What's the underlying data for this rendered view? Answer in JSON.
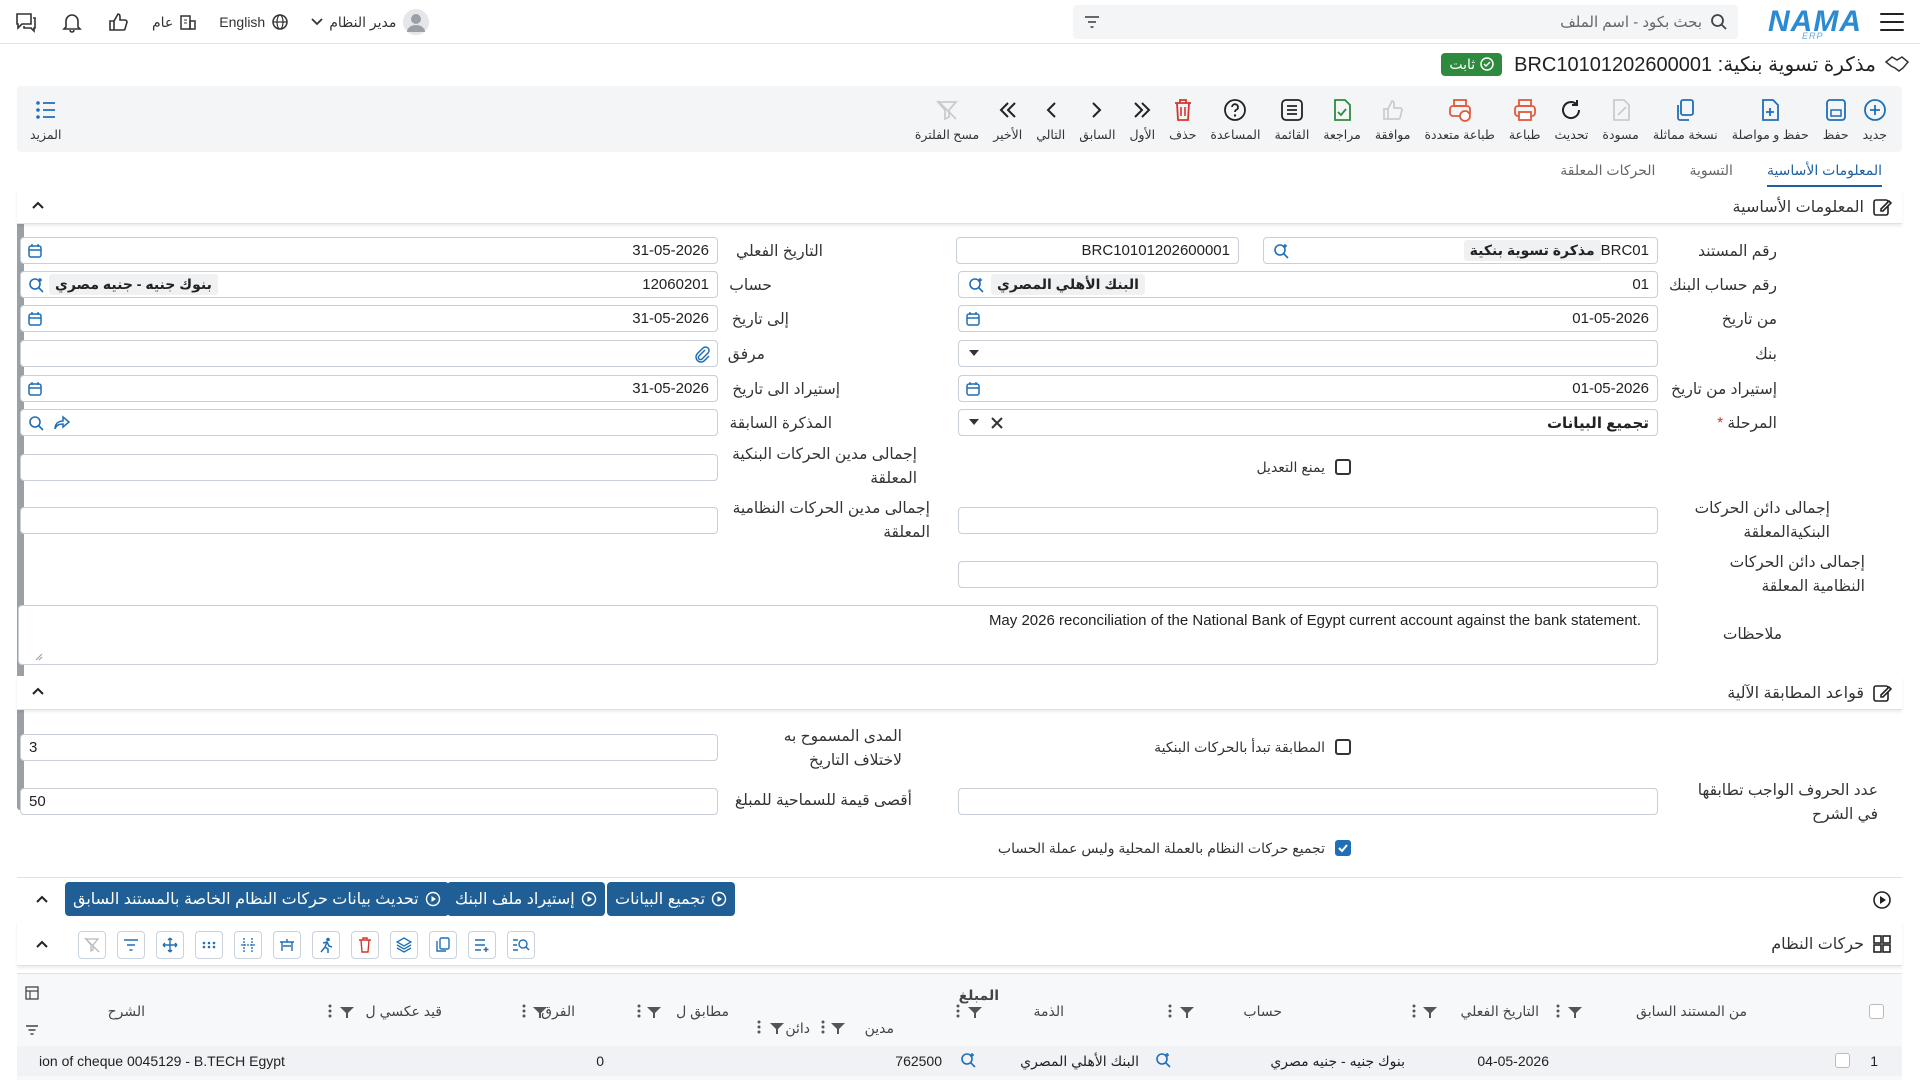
{
  "app": {
    "brand": "NAMA",
    "brand_sub": "ERP"
  },
  "search": {
    "placeholder": "بحث بكود - اسم الملف"
  },
  "topright": {
    "user": "مدير النظام",
    "language": "English",
    "scope": "عام"
  },
  "document": {
    "title": "مذكرة تسوية بنكية: BRC10101202600001",
    "status": "ثابت"
  },
  "toolbar": {
    "new": "جديد",
    "save": "حفظ",
    "save_continue": "حفظ و مواصلة",
    "copy": "نسخة مماثلة",
    "draft": "مسودة",
    "refresh": "تحديث",
    "print": "طباعة",
    "multi_print": "طباعة متعددة",
    "approve": "موافقة",
    "review": "مراجعة",
    "list": "القائمة",
    "help": "المساعدة",
    "delete": "حذف",
    "first": "الأول",
    "prev": "السابق",
    "next": "التالي",
    "last": "الأخير",
    "clear_filter": "مسح الفلترة",
    "more": "المزيد"
  },
  "tabs": [
    {
      "label": "المعلومات الأساسية",
      "active": true
    },
    {
      "label": "التسوية",
      "active": false
    },
    {
      "label": "الحركات المعلقة",
      "active": false
    }
  ],
  "basic": {
    "section_title": "المعلومات الأساسية",
    "doc_no_label": "رقم المستند",
    "doc_no_code": "BRC01",
    "doc_type": "مذكرة تسوية بنكية",
    "doc_no": "BRC10101202600001",
    "actual_date_label": "التاريخ الفعلي",
    "actual_date": "31-05-2026",
    "bank_acc_label": "رقم حساب البنك",
    "bank_acc": "01",
    "bank_acc_name": "البنك الأهلي المصري",
    "account_label": "حساب",
    "account": "12060201",
    "account_name": "بنوك جنيه - جنيه مصري",
    "from_date_label": "من تاريخ",
    "from_date": "01-05-2026",
    "to_date_label": "إلى تاريخ",
    "to_date": "31-05-2026",
    "bank_label": "بنك",
    "attachment_label": "مرفق",
    "import_from_label": "إستيراد من تاريخ",
    "import_from": "01-05-2026",
    "import_to_label": "إستيراد الى تاريخ",
    "import_to": "31-05-2026",
    "stage_label": "المرحلة",
    "stage": "تجميع البيانات",
    "prev_note_label": "المذكرة السابقة",
    "prevent_edit_label": "يمنع التعديل",
    "bank_debit_label": "إجمالى مدين الحركات البنكية المعلقة",
    "bank_credit_label": "إجمالى دائن الحركات البنكيةالمعلقة",
    "sys_debit_label": "إجمالى مدين الحركات النظامية المعلقة",
    "sys_credit_label": "إجمالى دائن الحركات النظامية المعلقة",
    "notes_label": "ملاحظات",
    "notes": "May 2026 reconciliation of the National Bank of Egypt current account against the bank statement."
  },
  "rules": {
    "section_title": "قواعد المطابقة الآلية",
    "start_bank_label": "المطابقة تبدأ بالحركات البنكية",
    "date_tolerance_label": "المدى المسموح به لاختلاف التاريخ",
    "date_tolerance": "3",
    "chars_label": "عدد الحروف الواجب تطابقها في الشرح",
    "amount_tolerance_label": "أقصى قيمة للسماحية للمبلغ",
    "amount_tolerance": "50",
    "local_currency_label": "تجميع حركات النظام بالعملة المحلية وليس عملة الحساب"
  },
  "actions": {
    "collect": "تجميع البيانات",
    "import_bank": "إستيراد ملف البنك",
    "update_prev": "تحديث بيانات حركات النظام الخاصة بالمستند السابق"
  },
  "grid": {
    "title": "حركات النظام",
    "columns": {
      "from_prev": "من المستند السابق",
      "actual_date": "التاريخ الفعلي",
      "account": "حساب",
      "party": "الذمة",
      "amount": "المبلغ",
      "debit": "مدين",
      "credit": "دائن",
      "matched": "مطابق ل",
      "diff": "الفرق",
      "reverse": "قيد عكسي ل",
      "desc": "الشرح"
    },
    "rows": [
      {
        "n": "1",
        "date": "04-05-2026",
        "account": "بنوك جنيه - جنيه مصري",
        "party": "البنك الأهلي المصري",
        "debit": "762500",
        "diff": "0",
        "desc": "ion of cheque 0045129 - B.TECH Egypt"
      }
    ]
  }
}
